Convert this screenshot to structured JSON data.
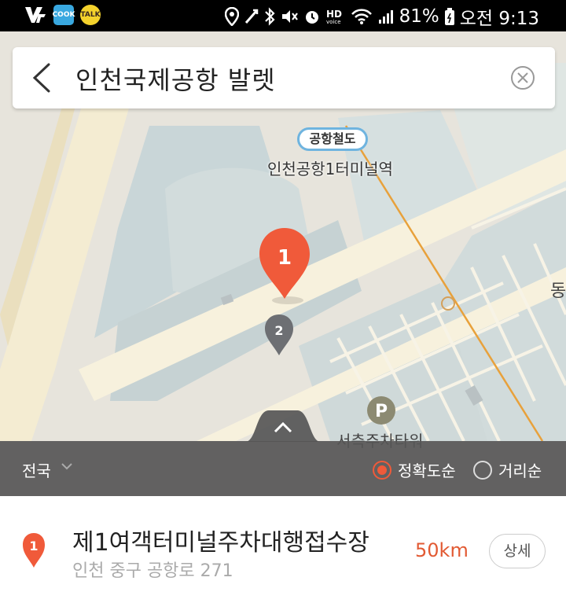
{
  "status_bar": {
    "carrier_icon": "kt-logo-icon",
    "apps": [
      {
        "name": "cook-app-icon",
        "label": "COOK",
        "color": "#39a8e0"
      },
      {
        "name": "kakaotalk-icon",
        "label": "TALK",
        "color": "#f4d22c"
      }
    ],
    "battery": "81%",
    "clock": "오전 9:13"
  },
  "search": {
    "query": "인천국제공항 발렛"
  },
  "map": {
    "station_badge": "공항철도",
    "station_name": "인천공항1터미널역",
    "parking_name": "서측주차타워",
    "edge_label": "동",
    "markers": [
      {
        "label": "1",
        "color": "#f05a3a"
      },
      {
        "label": "2",
        "color": "#6d6f73"
      }
    ]
  },
  "sort_bar": {
    "region": "전국",
    "options": [
      {
        "label": "정확도순",
        "selected": true
      },
      {
        "label": "거리순",
        "selected": false
      }
    ],
    "accent": "#f05a3a"
  },
  "result": {
    "index": "1",
    "title": "제1여객터미널주차대행접수장",
    "address": "인천 중구 공항로 271",
    "distance": "50km",
    "detail_label": "상세"
  }
}
